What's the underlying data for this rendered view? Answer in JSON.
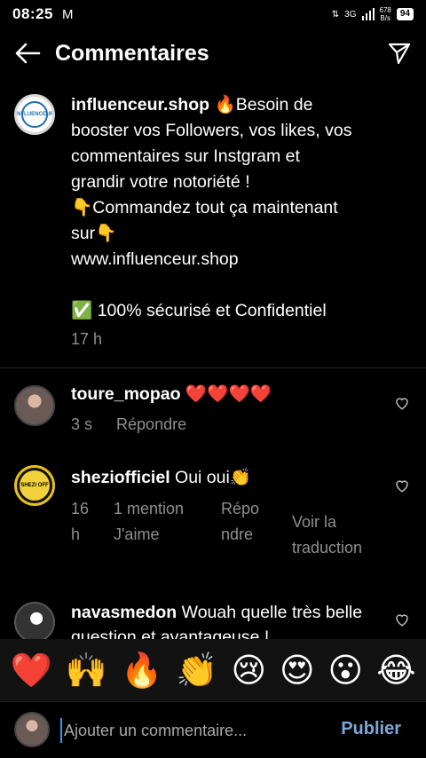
{
  "status_bar": {
    "time": "08:25",
    "mail_icon": "M",
    "network": "3G",
    "speed_value": "678",
    "speed_unit": "B/s",
    "battery": "94"
  },
  "header": {
    "title": "Commentaires",
    "back_icon": "arrow-left-icon",
    "send_icon": "paper-plane-icon"
  },
  "caption": {
    "username": "influenceur.shop",
    "avatar_label": "INFLUENCEUR",
    "lines": [
      " 🔥Besoin de",
      "booster vos Followers, vos likes, vos",
      "commentaires sur Instgram et",
      "grandir votre notoriété !",
      "👇Commandez tout ça maintenant",
      "sur👇",
      " www.influenceur.shop",
      "",
      "✅ 100% sécurisé et Confidentiel"
    ],
    "time": "17 h"
  },
  "comments": [
    {
      "username": "toure_mopao",
      "text": " ❤️❤️❤️❤️",
      "time": "3 s",
      "reply": "Répondre"
    },
    {
      "username": "sheziofficiel",
      "text": " Oui oui👏",
      "avatar_label": "SHEZI OFF",
      "time_line1": "16",
      "time_line2": "h",
      "mention_line1": "1 mention",
      "mention_line2": "J'aime",
      "reply_line1": "Répo",
      "reply_line2": "ndre",
      "translate_line1": "Voir la",
      "translate_line2": "traduction"
    },
    {
      "username": "navasmedon",
      "text_line1": " Wouah quelle très belle",
      "text_line2": "question et avantageuse !"
    }
  ],
  "emoji_bar": [
    "❤️",
    "🙌",
    "🔥",
    "👏",
    "😢",
    "😍",
    "😮",
    "😂"
  ],
  "composer": {
    "placeholder": "Ajouter un commentaire...",
    "publish": "Publier"
  },
  "colors": {
    "background": "#000000",
    "secondary_text": "#8e8e8e",
    "publish": "#7ea7d8"
  }
}
